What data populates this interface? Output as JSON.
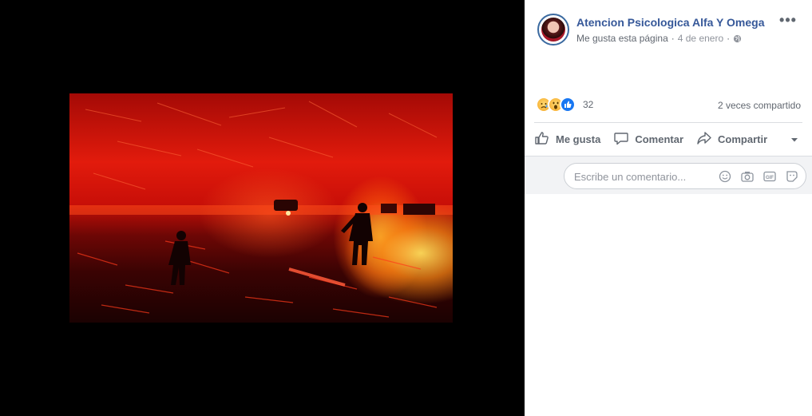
{
  "post": {
    "page_name": "Atencion Psicologica Alfa Y Omega",
    "like_page": "Me gusta esta página",
    "separator": "·",
    "date": "4 de enero",
    "privacy_icon": "globe-icon",
    "more_icon": "•••"
  },
  "photo": {
    "description_icon": "fire-scene-image"
  },
  "reactions": {
    "icons": [
      "sad-reaction-icon",
      "wow-reaction-icon",
      "like-reaction-icon"
    ],
    "count": "32",
    "shares": "2 veces compartido"
  },
  "actions": {
    "like": "Me gusta",
    "comment": "Comentar",
    "share": "Compartir"
  },
  "comment": {
    "placeholder": "Escribe un comentario...",
    "tools": [
      "emoji-icon",
      "camera-icon",
      "gif-icon",
      "sticker-icon"
    ]
  },
  "colors": {
    "link": "#365899",
    "muted": "#616770",
    "like_blue": "#1877f2",
    "comment_bg": "#f2f3f5"
  }
}
